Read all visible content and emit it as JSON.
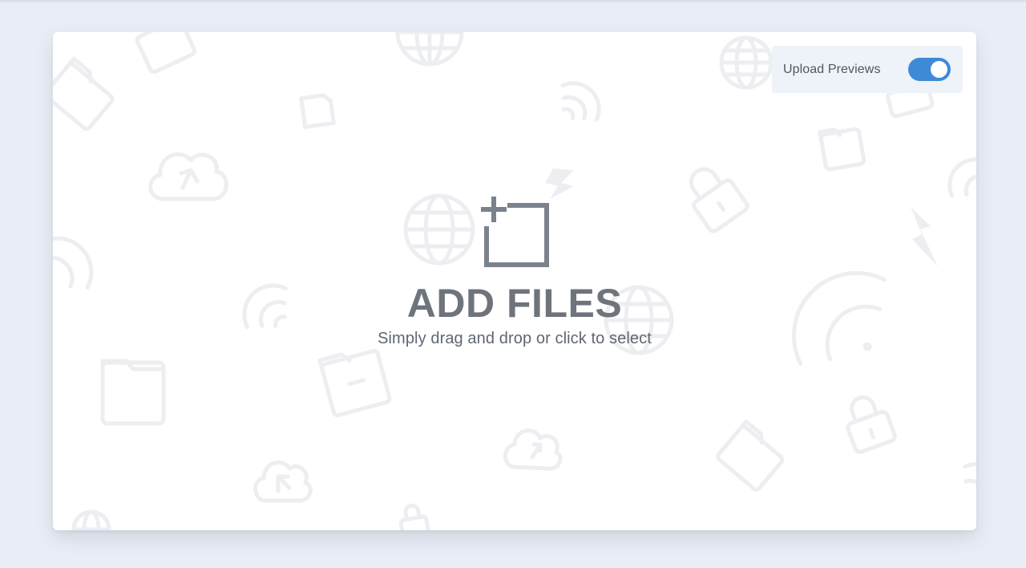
{
  "uploader": {
    "title": "ADD FILES",
    "subtitle": "Simply drag and drop or click to select",
    "main_icon": "add-files-icon",
    "background_icons": [
      "globe-icon",
      "cloud-upload-icon",
      "folder-icon",
      "wifi-icon",
      "lock-icon",
      "lightning-icon",
      "file-icon"
    ]
  },
  "preview_toggle": {
    "label": "Upload Previews",
    "enabled": true
  },
  "colors": {
    "page_background": "#e9eef6",
    "card_background": "#ffffff",
    "toggle_on": "#3e8ad6",
    "toggle_panel": "#eef2f9",
    "title_text": "#6e747c"
  }
}
